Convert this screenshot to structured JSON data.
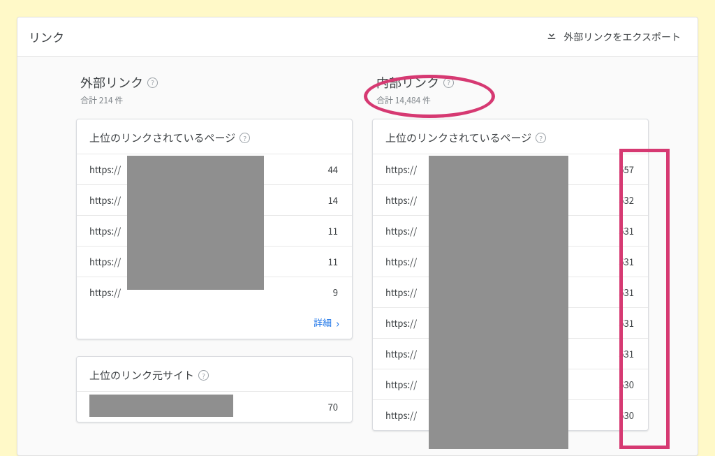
{
  "topbar": {
    "title": "リンク",
    "export_label": "外部リンクをエクスポート"
  },
  "external": {
    "heading": "外部リンク",
    "total": "合計 214 件",
    "top_linked": {
      "title": "上位のリンクされているページ",
      "rows": [
        {
          "url": "https://",
          "count": "44"
        },
        {
          "url": "https://",
          "count": "14"
        },
        {
          "url": "https://",
          "count": "11"
        },
        {
          "url": "https://",
          "count": "11"
        },
        {
          "url": "https://",
          "count": "9"
        }
      ],
      "more_label": "詳細"
    },
    "top_sites": {
      "title": "上位のリンク元サイト",
      "rows": [
        {
          "url": "",
          "count": "70"
        }
      ]
    }
  },
  "internal": {
    "heading": "内部リンク",
    "total": "合計 14,484 件",
    "top_linked": {
      "title": "上位のリンクされているページ",
      "rows": [
        {
          "url": "https://",
          "count": "557"
        },
        {
          "url": "https://",
          "count": "532"
        },
        {
          "url": "https://",
          "count": "531"
        },
        {
          "url": "https://",
          "count": "531"
        },
        {
          "url": "https://",
          "count": "531"
        },
        {
          "url": "https://",
          "count": "531"
        },
        {
          "url": "https://",
          "count": "531"
        },
        {
          "url": "https://",
          "count": "530"
        },
        {
          "url": "https://",
          "count": "530"
        }
      ]
    }
  }
}
